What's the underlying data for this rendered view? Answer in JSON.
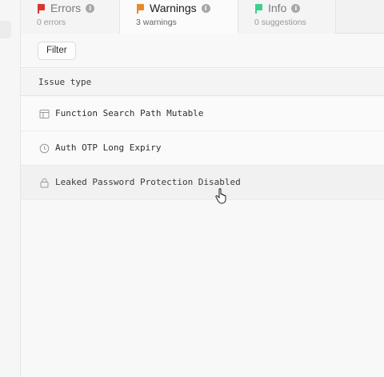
{
  "tabs": [
    {
      "label": "Errors",
      "sub": "0 errors",
      "flag": "red-flag-icon",
      "color": "#d8362d"
    },
    {
      "label": "Warnings",
      "sub": "3 warnings",
      "flag": "orange-flag-icon",
      "color": "#e8882a"
    },
    {
      "label": "Info",
      "sub": "0 suggestions",
      "flag": "green-flag-icon",
      "color": "#3ecf8e"
    }
  ],
  "active_tab": "Warnings",
  "toolbar": {
    "filter_label": "Filter"
  },
  "table": {
    "header": "Issue type",
    "rows": [
      {
        "label": "Function Search Path Mutable",
        "icon": "table-icon"
      },
      {
        "label": "Auth OTP Long Expiry",
        "icon": "clock-icon"
      },
      {
        "label": "Leaked Password Protection Disabled",
        "icon": "lock-icon"
      }
    ]
  }
}
